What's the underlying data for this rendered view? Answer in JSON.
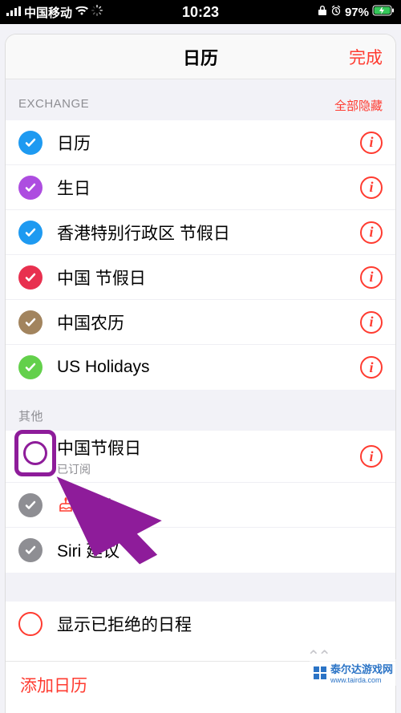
{
  "statusbar": {
    "carrier": "中国移动",
    "time": "10:23",
    "battery": "97%"
  },
  "nav": {
    "title": "日历",
    "done": "完成"
  },
  "sections": {
    "exchange": {
      "title": "EXCHANGE",
      "hideAll": "全部隐藏"
    },
    "other": {
      "title": "其他"
    }
  },
  "exchangeItems": [
    {
      "label": "日历",
      "color": "#1e9af1",
      "checked": true
    },
    {
      "label": "生日",
      "color": "#ad4de0",
      "checked": true
    },
    {
      "label": "香港特别行政区 节假日",
      "color": "#1e9af1",
      "checked": true
    },
    {
      "label": "中国 节假日",
      "color": "#e8304f",
      "checked": true
    },
    {
      "label": "中国农历",
      "color": "#a2845e",
      "checked": true
    },
    {
      "label": "US Holidays",
      "color": "#63d04b",
      "checked": true
    }
  ],
  "otherItems": [
    {
      "label": "中国节假日",
      "sub": "已订阅",
      "color": "#ff3b30",
      "checked": false,
      "info": true
    },
    {
      "label": "生日",
      "color": "#8e8e93",
      "checked": true,
      "birthdayIcon": true,
      "info": false
    },
    {
      "label": "Siri 建议",
      "color": "#8e8e93",
      "checked": true,
      "info": false
    }
  ],
  "rejected": {
    "label": "显示已拒绝的日程"
  },
  "bottom": {
    "add": "添加日历"
  },
  "watermark": {
    "text": "泰尔达游戏网",
    "url": "www.tairda.com"
  }
}
